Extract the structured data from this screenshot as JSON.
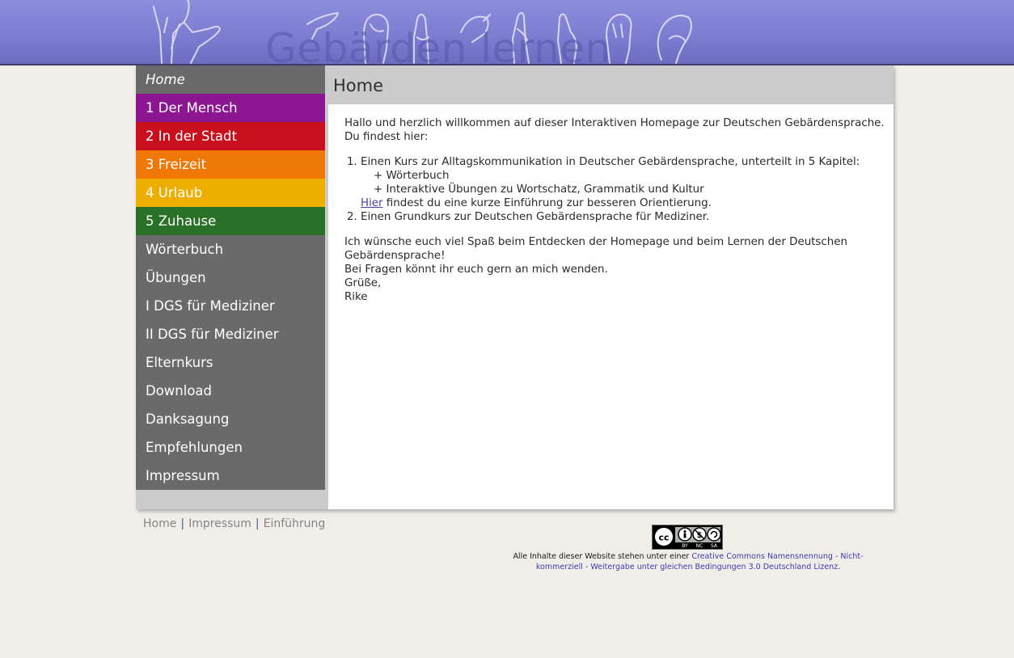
{
  "header": {
    "site_title": "Gebärden lernen",
    "decoration": "hand-signs-icon"
  },
  "sidebar": {
    "items": [
      {
        "label": "Home",
        "color": "#6a6a6a"
      },
      {
        "label": "1 Der Mensch",
        "color": "#8c1592"
      },
      {
        "label": "2 In der Stadt",
        "color": "#c8101d"
      },
      {
        "label": "3 Freizeit",
        "color": "#ef7806"
      },
      {
        "label": "4 Urlaub",
        "color": "#edae00"
      },
      {
        "label": "5 Zuhause",
        "color": "#2a7128"
      },
      {
        "label": "Wörterbuch",
        "color": "#6a6a6a"
      },
      {
        "label": "Übungen",
        "color": "#6a6a6a"
      },
      {
        "label": "I DGS für Mediziner",
        "color": "#6a6a6a"
      },
      {
        "label": "II DGS für Mediziner",
        "color": "#6a6a6a"
      },
      {
        "label": "Elternkurs",
        "color": "#6a6a6a"
      },
      {
        "label": "Download",
        "color": "#6a6a6a"
      },
      {
        "label": "Danksagung",
        "color": "#6a6a6a"
      },
      {
        "label": "Empfehlungen",
        "color": "#6a6a6a"
      },
      {
        "label": "Impressum",
        "color": "#6a6a6a"
      }
    ]
  },
  "main": {
    "title": "Home",
    "intro": "Hallo und herzlich willkommen auf dieser Interaktiven Homepage zur Deutschen Gebärdensprache. Du findest hier:",
    "list": {
      "item1": "Einen Kurs zur Alltagskommunikation in Deutscher Gebärdensprache, unterteilt in 5 Kapitel:",
      "item1_sub1": "+ Wörterbuch",
      "item1_sub2": "+ Interaktive Übungen zu Wortschatz, Grammatik und Kultur",
      "item1_link": "Hier",
      "item1_link_tail": " findest du eine kurze Einführung zur besseren Orientierung.",
      "item2": "Einen Grundkurs zur Deutschen Gebärdensprache für Mediziner."
    },
    "closing": "Ich wünsche euch viel Spaß beim Entdecken der Homepage und beim Lernen der Deutschen Gebärdensprache!",
    "questions": "Bei Fragen könnt ihr euch gern an mich wenden.",
    "greeting": "Grüße,",
    "signature": "Rike"
  },
  "footer": {
    "links": [
      "Home",
      "Impressum",
      "Einführung"
    ],
    "separator": "|",
    "cc_badge": {
      "icon": "creative-commons-icon",
      "labels": [
        "BY",
        "NC",
        "SA"
      ]
    },
    "license_prefix": "Alle Inhalte dieser Website stehen unter einer ",
    "license_link": "Creative Commons Namensnennung - Nicht-kommerziell - Weitergabe unter gleichen Bedingungen 3.0 Deutschland Lizenz",
    "license_suffix": "."
  },
  "colors": {
    "background": "#f1ede8",
    "header": "#7b7bcf",
    "link": "#4b3fa4"
  }
}
